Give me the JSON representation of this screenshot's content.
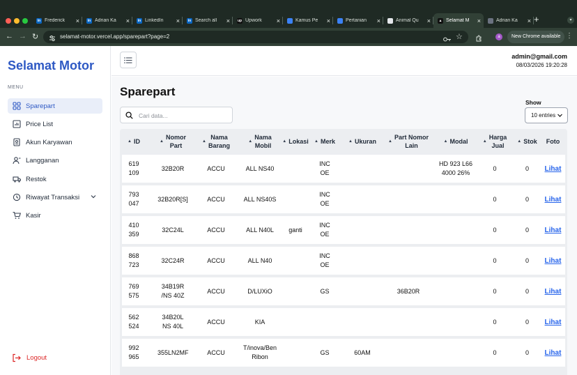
{
  "browser": {
    "tabs": [
      {
        "title": "Frederick",
        "favicon": "linkedin-icon",
        "color": "#0a66c2",
        "glyph": "in"
      },
      {
        "title": "Adrian Ka",
        "favicon": "linkedin-icon",
        "color": "#0a66c2",
        "glyph": "in"
      },
      {
        "title": "LinkedIn",
        "favicon": "linkedin-icon",
        "color": "#0a66c2",
        "glyph": "in"
      },
      {
        "title": "Search all",
        "favicon": "linkedin-icon",
        "color": "#0a66c2",
        "glyph": "in"
      },
      {
        "title": "Upwork",
        "favicon": "upwork-icon",
        "color": "#111111",
        "glyph": "up"
      },
      {
        "title": "Kamus Pe",
        "favicon": "doc-icon",
        "color": "#3b82f6",
        "glyph": ""
      },
      {
        "title": "Pertanian",
        "favicon": "doc-icon",
        "color": "#3b82f6",
        "glyph": ""
      },
      {
        "title": "Animal Qu",
        "favicon": "chatgpt-icon",
        "color": "#e5e7eb",
        "glyph": ""
      },
      {
        "title": "Selamat M",
        "favicon": "vercel-icon",
        "color": "#111111",
        "glyph": "▲",
        "active": true
      },
      {
        "title": "Adrian Ka",
        "favicon": "github-icon",
        "color": "#6b7280",
        "glyph": ""
      }
    ],
    "url": "selamat-motor.vercel.app/sparepart?page=2",
    "profile_initial": "a",
    "update_label": "New Chrome available"
  },
  "sidebar": {
    "brand": "Selamat Motor",
    "menu_label": "MENU",
    "items": [
      {
        "label": "Sparepart",
        "icon": "grid-icon",
        "active": true
      },
      {
        "label": "Price List",
        "icon": "chart-icon"
      },
      {
        "label": "Akun Karyawan",
        "icon": "id-card-icon"
      },
      {
        "label": "Langganan",
        "icon": "users-icon"
      },
      {
        "label": "Restok",
        "icon": "truck-icon"
      },
      {
        "label": "Riwayat Transaksi",
        "icon": "history-icon",
        "expandable": true
      },
      {
        "label": "Kasir",
        "icon": "cart-icon"
      }
    ],
    "logout_label": "Logout"
  },
  "header": {
    "user_email": "admin@gmail.com",
    "datetime": "08/03/2026 19:20:28"
  },
  "main": {
    "title": "Sparepart",
    "search_placeholder": "Cari data...",
    "show_label": "Show",
    "show_value": "10 entries"
  },
  "table": {
    "columns": [
      "ID",
      "Nomor Part",
      "Nama Barang",
      "Nama Mobil",
      "Lokasi",
      "Merk",
      "Ukuran",
      "Part Nomor Lain",
      "Modal",
      "Harga Jual",
      "Stok",
      "Foto"
    ],
    "column_display": [
      "ID",
      "Nomor\nPart",
      "Nama\nBarang",
      "Nama\nMobil",
      "Lokasi",
      "Merk",
      "Ukuran",
      "Part Nomor\nLain",
      "Modal",
      "Harga\nJual",
      "Stok",
      "Foto"
    ],
    "rows": [
      [
        "619109",
        "32B20R",
        "ACCU",
        "ALL NS40",
        "",
        "INCOE",
        "",
        "",
        "HD 923 L66 4000 26%",
        "0",
        "0",
        "Lihat"
      ],
      [
        "793047",
        "32B20R[S]",
        "ACCU",
        "ALL NS40S",
        "",
        "INCOE",
        "",
        "",
        "",
        "0",
        "0",
        "Lihat"
      ],
      [
        "410359",
        "32C24L",
        "ACCU",
        "ALL N40L",
        "ganti",
        "INCOE",
        "",
        "",
        "",
        "0",
        "0",
        "Lihat"
      ],
      [
        "868723",
        "32C24R",
        "ACCU",
        "ALL N40",
        "",
        "INCOE",
        "",
        "",
        "",
        "0",
        "0",
        "Lihat"
      ],
      [
        "769575",
        "34B19R /NS 40Z",
        "ACCU",
        "D/LUXiO",
        "",
        "GS",
        "",
        "36B20R",
        "",
        "0",
        "0",
        "Lihat"
      ],
      [
        "562524",
        "34B20L NS 40L",
        "ACCU",
        "KIA",
        "",
        "",
        "",
        "",
        "",
        "0",
        "0",
        "Lihat"
      ],
      [
        "992965",
        "355LN2MF",
        "ACCU",
        "T/inova/Ben Ribon",
        "",
        "GS",
        "60AM",
        "",
        "",
        "0",
        "0",
        "Lihat"
      ]
    ]
  }
}
